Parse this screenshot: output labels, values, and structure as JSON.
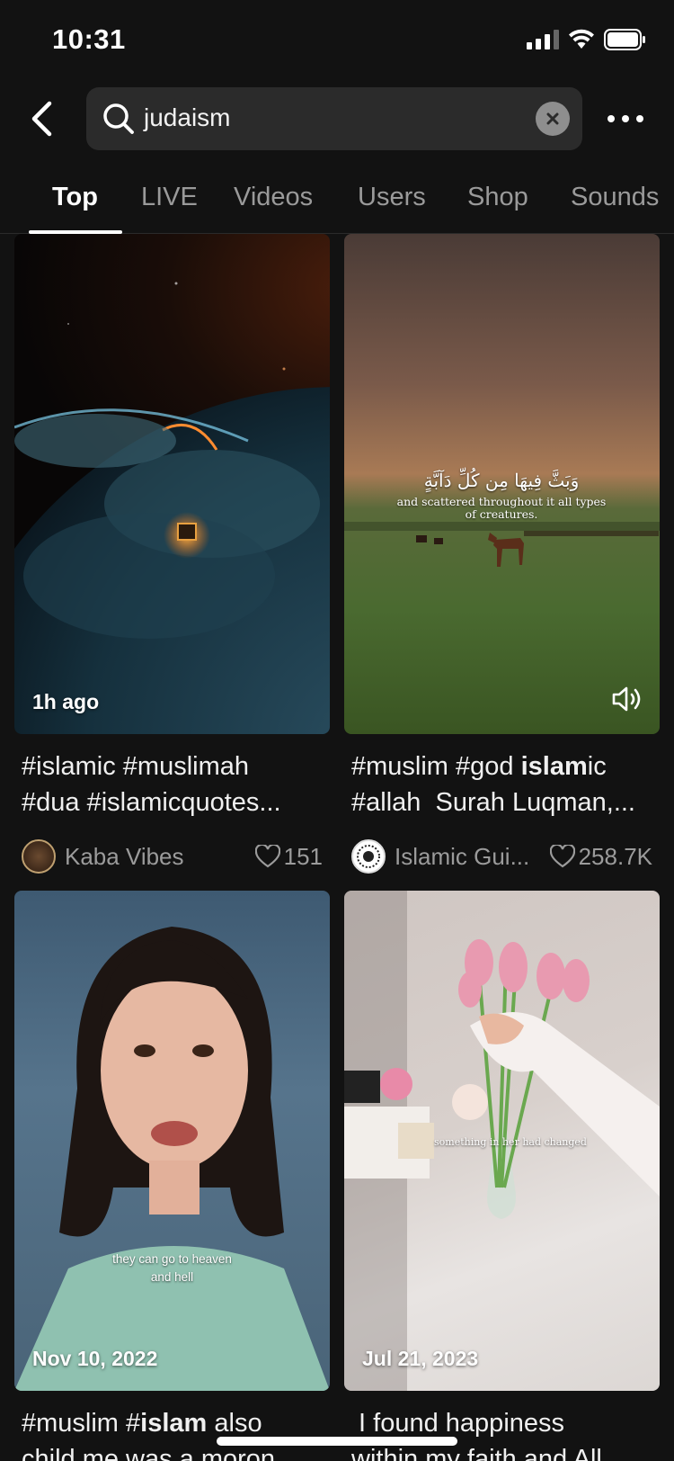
{
  "status": {
    "time": "10:31"
  },
  "search": {
    "query": "judaism"
  },
  "tabs": [
    {
      "label": "Top"
    },
    {
      "label": "LIVE"
    },
    {
      "label": "Videos"
    },
    {
      "label": "Users"
    },
    {
      "label": "Shop"
    },
    {
      "label": "Sounds"
    }
  ],
  "results": [
    {
      "overlay": "1h ago",
      "caption_line1": "#islamic #muslimah",
      "caption_line2": "#dua #islamicquotes...",
      "author": "Kaba Vibes",
      "likes": "151"
    },
    {
      "video_text_arabic": "وَبَثَّ فِيهَا مِن كُلِّ دَآبَّةٍ",
      "video_text_line1": "and scattered throughout it all types",
      "video_text_line2": "of creatures.",
      "caption_pre": "#muslim #god ",
      "caption_bold": "islam",
      "caption_post": "ic",
      "caption_line2": "#allah  Surah Luqman,...",
      "author": "Islamic Gui...",
      "likes": "258.7K"
    },
    {
      "overlay": "Nov 10, 2022",
      "video_text_line1": "they can go to heaven",
      "video_text_line2": "and hell",
      "caption_pre": "#muslim #",
      "caption_bold": "islam",
      "caption_post": " also",
      "caption_line2": "child me was a moron"
    },
    {
      "overlay": "Jul 21, 2023",
      "video_text_line1": "something in her had changed",
      "caption_line1": " I found happiness",
      "caption_line2": "within my faith and All"
    }
  ],
  "colors": {
    "background": "#121212",
    "search_bg": "#2b2b2b",
    "muted_text": "#9b9b9b"
  }
}
